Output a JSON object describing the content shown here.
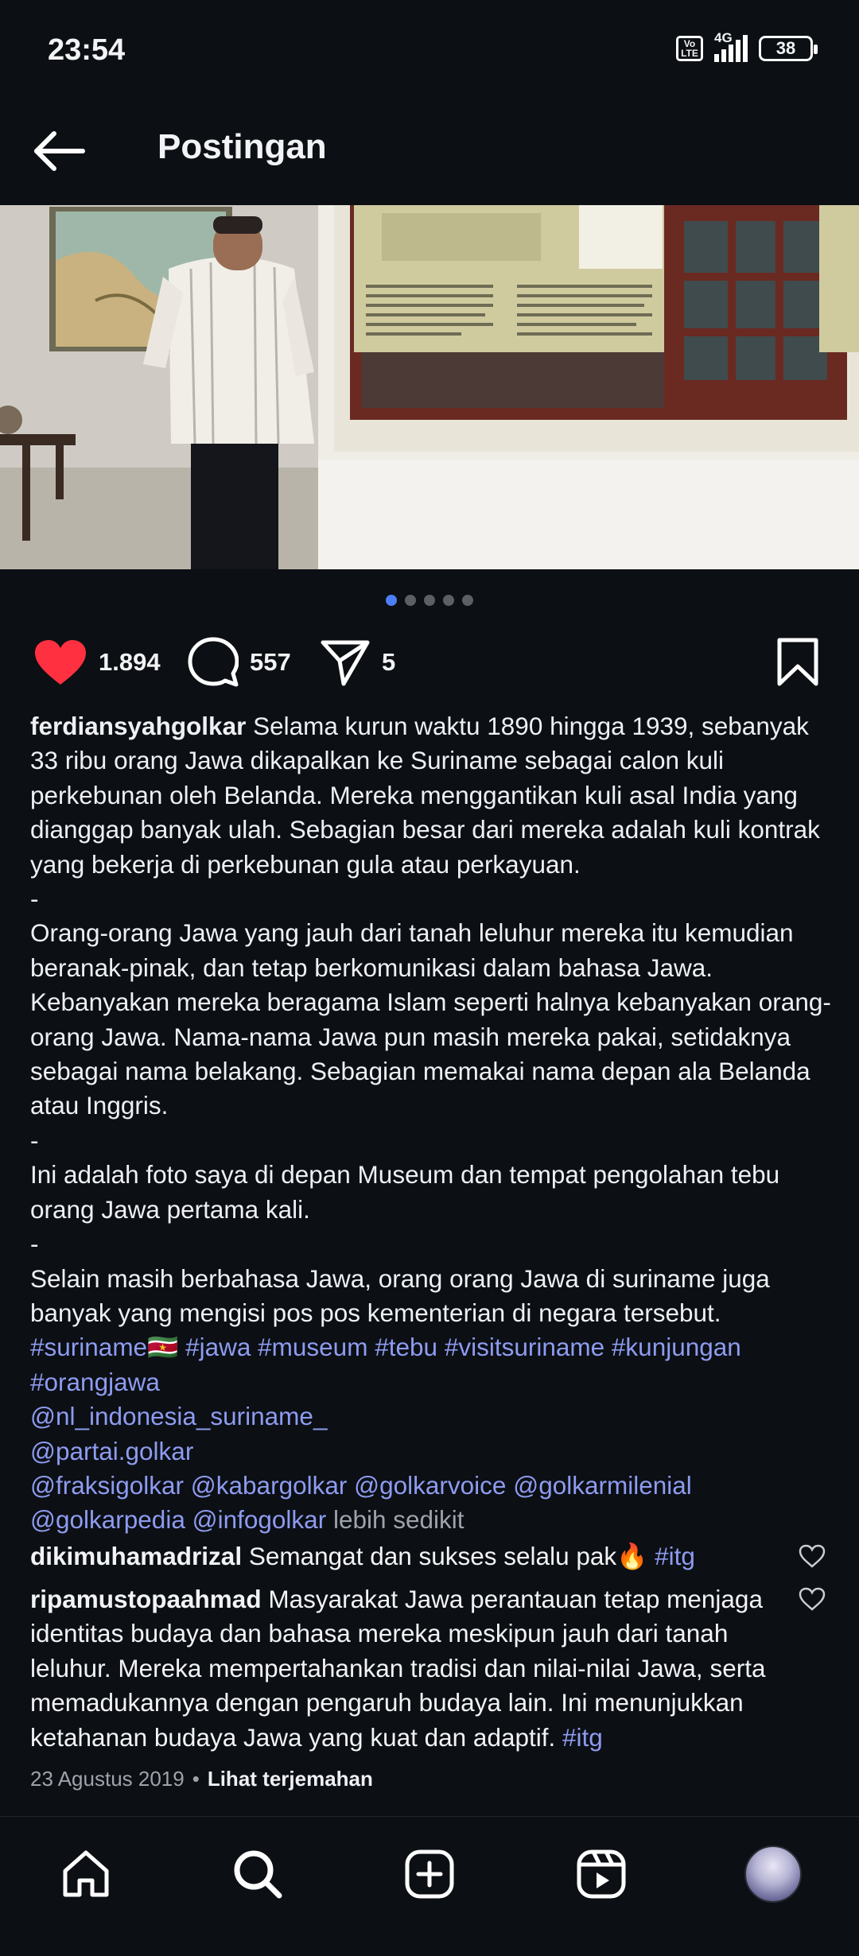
{
  "status_bar": {
    "time": "23:54",
    "volte": "Vo LTE",
    "network": "4G",
    "battery": "38"
  },
  "header": {
    "title": "Postingan",
    "back_icon": "arrow-left-icon"
  },
  "post": {
    "carousel": {
      "count": 5,
      "active_index": 0
    },
    "actions": {
      "likes": "1.894",
      "comments": "557",
      "shares": "5"
    },
    "caption": {
      "username": "ferdiansyahgolkar",
      "paragraph1": "Selama kurun waktu 1890 hingga 1939, sebanyak 33 ribu orang Jawa dikapalkan ke Suriname sebagai calon kuli perkebunan oleh Belanda. Mereka menggantikan kuli asal India yang dianggap banyak ulah. Sebagian besar dari mereka adalah kuli kontrak yang bekerja di perkebunan gula atau perkayuan.",
      "separator": "-",
      "paragraph2": "Orang-orang Jawa yang jauh dari tanah leluhur mereka itu kemudian beranak-pinak, dan tetap berkomunikasi dalam bahasa Jawa. Kebanyakan mereka beragama Islam seperti halnya kebanyakan orang-orang Jawa. Nama-nama Jawa pun masih mereka pakai, setidaknya sebagai nama belakang. Sebagian memakai nama depan ala Belanda atau Inggris.",
      "paragraph3": "Ini adalah foto saya di depan Museum dan tempat pengolahan tebu orang Jawa pertama kali.",
      "paragraph4": "Selain masih berbahasa Jawa, orang orang Jawa di suriname juga banyak yang mengisi pos pos kementerian di negara tersebut.",
      "hashtags_line1": [
        "#suriname🇸🇷",
        "#jawa",
        "#museum",
        "#tebu",
        "#visitsuriname",
        "#kunjungan"
      ],
      "hashtags_line2": "#orangjawa",
      "mention1": "@nl_indonesia_suriname_",
      "mention2": "@partai.golkar",
      "mentions_line3": [
        "@fraksigolkar",
        "@kabargolkar",
        "@golkarvoice",
        "@golkarmilenial"
      ],
      "mentions_line4": [
        "@golkarpedia",
        "@infogolkar"
      ],
      "less_label": "lebih sedikit"
    },
    "comments": [
      {
        "username": "dikimuhamadrizal",
        "text": "Semangat dan sukses selalu pak🔥",
        "tag": "#itg"
      },
      {
        "username": "ripamustopaahmad",
        "text": "Masyarakat Jawa perantauan tetap menjaga identitas budaya dan bahasa mereka meskipun jauh dari tanah leluhur. Mereka mempertahankan tradisi dan nilai-nilai Jawa, serta memadukannya dengan pengaruh budaya lain. Ini menunjukkan ketahanan budaya Jawa yang kuat dan adaptif.",
        "tag": "#itg"
      }
    ],
    "date": "23 Agustus 2019",
    "date_separator": "•",
    "translate_label": "Lihat terjemahan"
  },
  "bottom_nav": {
    "items": [
      "home-icon",
      "search-icon",
      "create-icon",
      "reels-icon",
      "profile-avatar"
    ]
  },
  "colors": {
    "background": "#0c0f14",
    "link": "#8d9cf0",
    "like": "#ff3040",
    "carousel_active": "#4c7ef5"
  }
}
